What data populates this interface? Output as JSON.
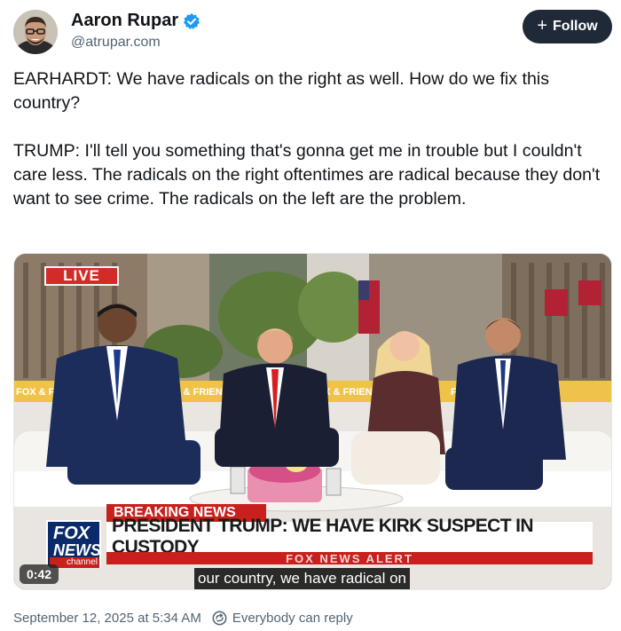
{
  "author": {
    "name": "Aaron Rupar",
    "handle": "@atrupar.com",
    "verified": true,
    "verified_color": "#1d9bf0"
  },
  "follow_button": {
    "label": "Follow",
    "icon": "plus-icon",
    "bg": "#1f2937"
  },
  "tweet": {
    "paragraph1": "EARHARDT: We have radicals on the right as well. How do we fix this country?",
    "paragraph2": "TRUMP: I'll tell you something that's gonna get me in trouble but I couldn't care less. The radicals on the right oftentimes are radical because they don't want to see crime. The radicals on the left are the problem."
  },
  "video": {
    "live_label": "LIVE",
    "breaking_label": "BREAKING NEWS",
    "headline": "PRESIDENT TRUMP: WE HAVE KIRK SUSPECT IN CUSTODY",
    "alert_label": "FOX NEWS ALERT",
    "logo_line1": "FOX",
    "logo_line2": "NEWS",
    "logo_line3": "channel",
    "backdrop_label": "FOX & FRIENDS",
    "elapsed": "0:42",
    "caption": "our country, we have radical on",
    "accent_red": "#c8201c",
    "fox_blue": "#0a2a6b"
  },
  "footer": {
    "date": "September 12, 2025 at 5:34 AM",
    "reply_setting": "Everybody can reply",
    "reply_icon": "reply-settings-icon"
  }
}
